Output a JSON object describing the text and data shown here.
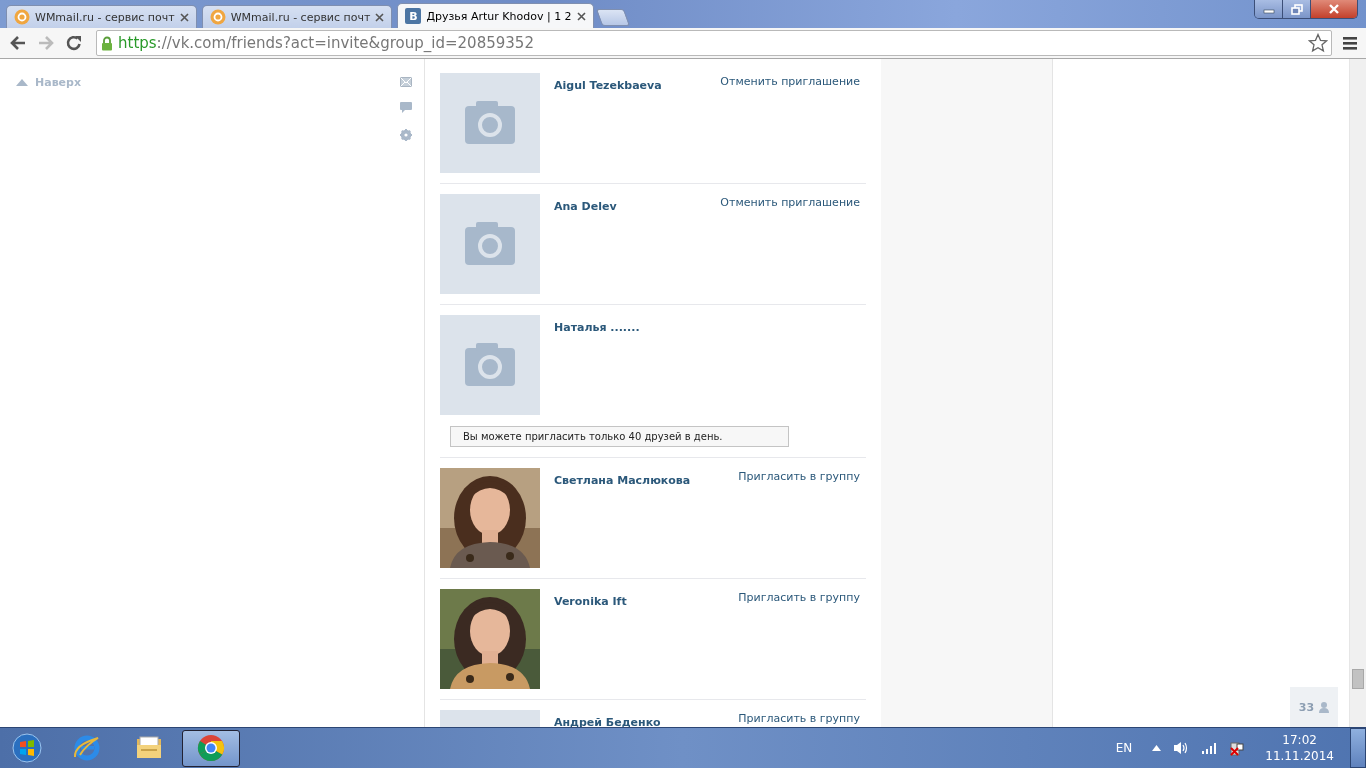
{
  "browser": {
    "tabs": [
      {
        "title": "WMmail.ru - сервис почт",
        "selected": false
      },
      {
        "title": "WMmail.ru - сервис почт",
        "selected": false
      },
      {
        "title": "Друзья Artur Khodov | 1 2",
        "icon_letter": "В",
        "selected": true
      }
    ],
    "url": {
      "scheme": "https",
      "rest": "://vk.com/friends?act=invite&group_id=20859352"
    }
  },
  "sidebar": {
    "top_link": "Наверх"
  },
  "friends": [
    {
      "kind": "friend",
      "name": "Aigul Tezekbaeva",
      "action": "Отменить приглашение"
    },
    {
      "kind": "friend",
      "name": "Ana Delev",
      "action": "Отменить приглашение"
    },
    {
      "kind": "friend",
      "name": "Наталья ......."
    },
    {
      "kind": "notice",
      "text": "Вы можете пригласить только 40 друзей в день."
    },
    {
      "kind": "friend",
      "name": "Светлана Маслюкова",
      "action": "Пригласить в группу"
    },
    {
      "kind": "friend",
      "name": "Veronika Ift",
      "action": "Пригласить в группу"
    },
    {
      "kind": "friend",
      "name": "Андрей Беденко",
      "action": "Пригласить в группу"
    }
  ],
  "online_counter": "33",
  "taskbar": {
    "apps": [
      {
        "selected": false
      },
      {
        "selected": false
      },
      {
        "selected": true
      }
    ],
    "language": "EN",
    "time": "17:02",
    "date": "11.11.2014"
  }
}
